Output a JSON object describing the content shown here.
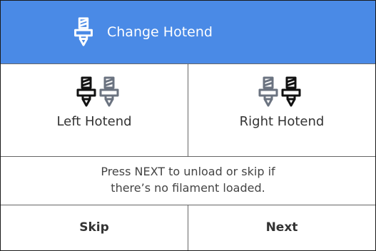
{
  "header": {
    "title": "Change Hotend",
    "icon": "hotend-icon"
  },
  "hotends": [
    {
      "label": "Left Hotend",
      "active_icon": "left",
      "icons": [
        "hotend-icon-dark",
        "hotend-icon-grey"
      ]
    },
    {
      "label": "Right Hotend",
      "active_icon": "right",
      "icons": [
        "hotend-icon-grey",
        "hotend-icon-dark"
      ]
    }
  ],
  "message": {
    "line1": "Press NEXT to unload or skip if",
    "line2": "there’s no filament loaded."
  },
  "footer": {
    "skip_label": "Skip",
    "next_label": "Next"
  },
  "colors": {
    "header_bg": "#4a8ae6",
    "icon_active": "#111111",
    "icon_inactive": "#6b7380",
    "text": "#333333"
  }
}
